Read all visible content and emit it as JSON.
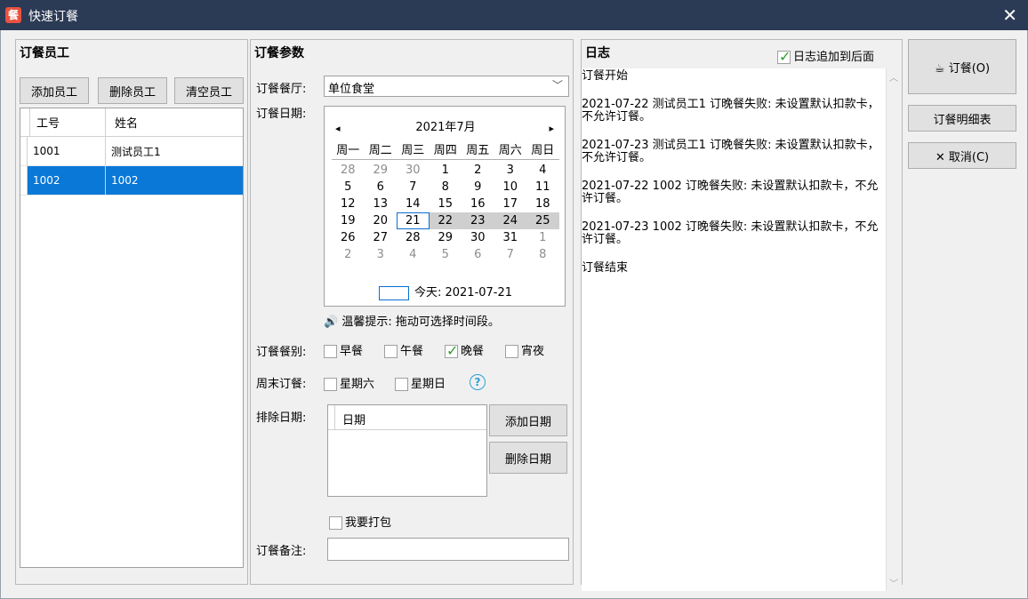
{
  "window": {
    "title": "快速订餐",
    "close_glyph": "✕",
    "app_icon_glyph": "餐"
  },
  "employees": {
    "title": "订餐员工",
    "add_label": "添加员工",
    "delete_label": "删除员工",
    "clear_label": "清空员工",
    "columns": [
      "工号",
      "姓名"
    ],
    "rows": [
      {
        "id": "1001",
        "name": "测试员工1",
        "selected": false
      },
      {
        "id": "1002",
        "name": "1002",
        "selected": true
      }
    ]
  },
  "params": {
    "title": "订餐参数",
    "restaurant_label": "订餐餐厅:",
    "restaurant_value": "单位食堂",
    "date_label": "订餐日期:",
    "calendar": {
      "month_title": "2021年7月",
      "prev": "◂",
      "next": "▸",
      "weekdays": [
        "周一",
        "周二",
        "周三",
        "周四",
        "周五",
        "周六",
        "周日"
      ],
      "today_label": "今天: 2021-07-21",
      "weeks": [
        [
          "28",
          "29",
          "30",
          "1",
          "2",
          "3",
          "4"
        ],
        [
          "5",
          "6",
          "7",
          "8",
          "9",
          "10",
          "11"
        ],
        [
          "12",
          "13",
          "14",
          "15",
          "16",
          "17",
          "18"
        ],
        [
          "19",
          "20",
          "21",
          "22",
          "23",
          "24",
          "25"
        ],
        [
          "26",
          "27",
          "28",
          "29",
          "30",
          "31",
          "1"
        ],
        [
          "2",
          "3",
          "4",
          "5",
          "6",
          "7",
          "8"
        ]
      ]
    },
    "tip": "温馨提示: 拖动可选择时间段。",
    "meal_label": "订餐餐别:",
    "meals": [
      {
        "label": "早餐",
        "checked": false
      },
      {
        "label": "午餐",
        "checked": false
      },
      {
        "label": "晚餐",
        "checked": true
      },
      {
        "label": "宵夜",
        "checked": false
      }
    ],
    "weekend_label": "周末订餐:",
    "weekend": [
      {
        "label": "星期六",
        "checked": false
      },
      {
        "label": "星期日",
        "checked": false
      }
    ],
    "help_glyph": "?",
    "exclude_label": "排除日期:",
    "exclude_column": "日期",
    "add_date_label": "添加日期",
    "delete_date_label": "删除日期",
    "pack_label": "我要打包",
    "note_label": "订餐备注:",
    "note_value": ""
  },
  "log": {
    "title": "日志",
    "append_label": "日志追加到后面",
    "append_checked": true,
    "entries": [
      "订餐开始",
      "2021-07-22 测试员工1 订晚餐失败: 未设置默认扣款卡，不允许订餐。",
      "2021-07-23 测试员工1 订晚餐失败: 未设置默认扣款卡，不允许订餐。",
      "2021-07-22 1002 订晚餐失败: 未设置默认扣款卡，不允许订餐。",
      "2021-07-23 1002 订晚餐失败: 未设置默认扣款卡，不允许订餐。",
      "订餐结束"
    ]
  },
  "actions": {
    "order_label": "订餐(O)",
    "detail_label": "订餐明细表",
    "cancel_label": "取消(C)"
  }
}
